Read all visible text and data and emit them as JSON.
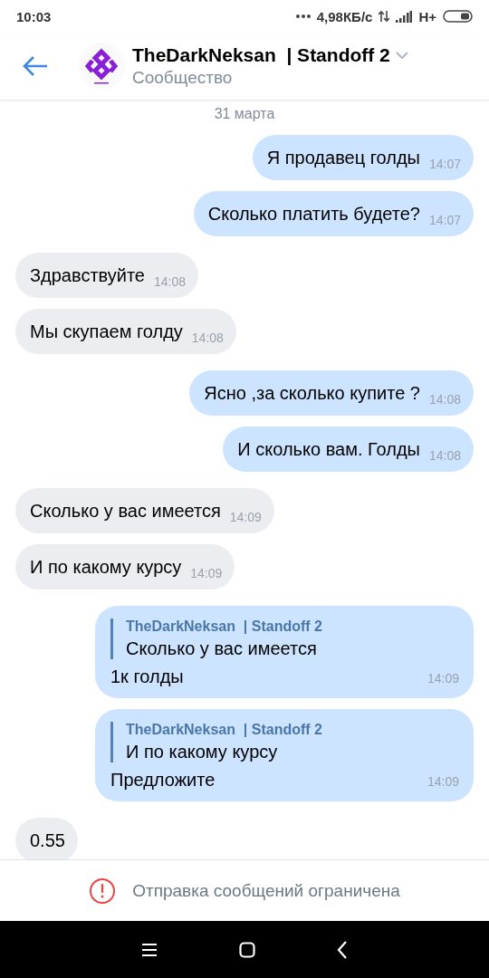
{
  "status_bar": {
    "time": "10:03",
    "speed": "4,98КБ/с",
    "network": "H+"
  },
  "header": {
    "title": "TheDarkNeksan  | Standoff 2",
    "subtitle": "Сообщество"
  },
  "date": "31 марта",
  "messages": [
    {
      "kind": "text",
      "outgoing": true,
      "text": "Я продавец голды",
      "time": "14:07"
    },
    {
      "kind": "text",
      "outgoing": true,
      "text": "Сколько платить будете?",
      "time": "14:07"
    },
    {
      "kind": "text",
      "outgoing": false,
      "text": "Здравствуйте",
      "time": "14:08"
    },
    {
      "kind": "text",
      "outgoing": false,
      "text": "Мы скупаем голду",
      "time": "14:08"
    },
    {
      "kind": "text",
      "outgoing": true,
      "text": "Ясно ,за сколько купите ?",
      "time": "14:08"
    },
    {
      "kind": "text",
      "outgoing": true,
      "text": "И сколько вам. Голды",
      "time": "14:08"
    },
    {
      "kind": "text",
      "outgoing": false,
      "text": "Сколько у вас имеется",
      "time": "14:09"
    },
    {
      "kind": "text",
      "outgoing": false,
      "text": "И по какому курсу",
      "time": "14:09"
    },
    {
      "kind": "reply",
      "outgoing": true,
      "quote_author": "TheDarkNeksan  | Standoff 2",
      "quote_text": "Сколько у вас имеется",
      "text": "1к голды",
      "time": "14:09"
    },
    {
      "kind": "reply",
      "outgoing": true,
      "quote_author": "TheDarkNeksan  | Standoff 2",
      "quote_text": "И по какому курсу",
      "text": "Предложите",
      "time": "14:09"
    },
    {
      "kind": "text",
      "outgoing": false,
      "text": "0.55"
    }
  ],
  "notice": "Отправка сообщений ограничена"
}
